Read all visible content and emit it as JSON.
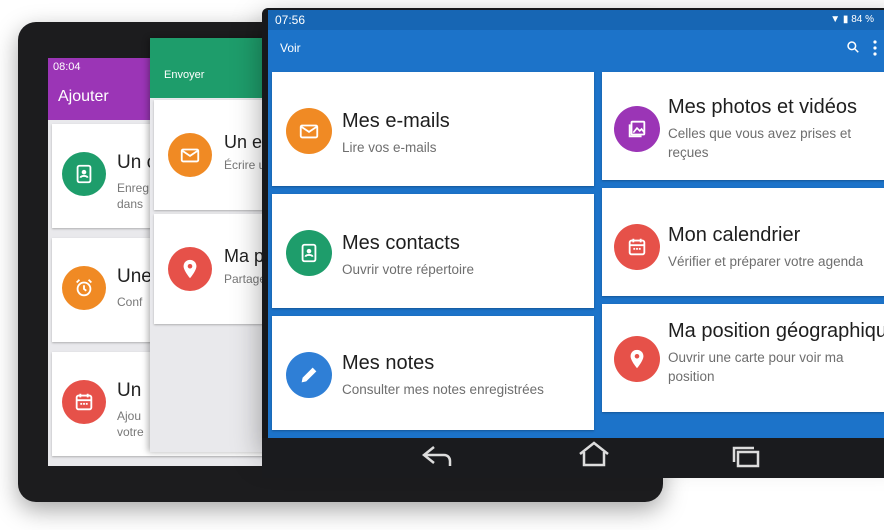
{
  "back_tablet": {
    "status_time": "08:04",
    "title": "Ajouter",
    "accent": "#9b35b6",
    "cards": [
      {
        "title": "Un c",
        "subtitle": "Enreg dans",
        "icon": "contact-icon",
        "color": "#1e9d6b"
      },
      {
        "title": "Une",
        "subtitle": "Conf",
        "icon": "alarm-icon",
        "color": "#f08a24"
      },
      {
        "title": "Un",
        "subtitle": "Ajou votre",
        "icon": "calendar-icon",
        "color": "#e65149"
      }
    ]
  },
  "mid_tablet": {
    "title": "Envoyer",
    "accent": "#1e9d6b",
    "cards": [
      {
        "title": "Un e-",
        "subtitle": "Écrire u",
        "icon": "email-icon",
        "color": "#f08a24"
      },
      {
        "title": "Ma po",
        "subtitle": "Partage",
        "icon": "location-icon",
        "color": "#e65149"
      }
    ]
  },
  "front_tablet": {
    "status_time": "07:56",
    "battery": "84 %",
    "title": "Voir",
    "accent": "#1c73c9",
    "cards": [
      {
        "title": "Mes e-mails",
        "subtitle": "Lire vos e-mails",
        "icon": "email-icon",
        "color": "#f08a24"
      },
      {
        "title": "Mes photos et vidéos",
        "subtitle": "Celles que vous avez prises et reçues",
        "icon": "photo-icon",
        "color": "#9b35b6"
      },
      {
        "title": "Mes contacts",
        "subtitle": "Ouvrir votre répertoire",
        "icon": "contact-icon",
        "color": "#1e9d6b"
      },
      {
        "title": "Mon calendrier",
        "subtitle": "Vérifier et préparer votre agenda",
        "icon": "calendar-icon",
        "color": "#e65149"
      },
      {
        "title": "Mes notes",
        "subtitle": "Consulter mes notes enregistrées",
        "icon": "pencil-icon",
        "color": "#2f7fd6"
      },
      {
        "title": "Ma position géographique",
        "subtitle": "Ouvrir une carte pour voir ma position",
        "icon": "location-icon",
        "color": "#e65149"
      }
    ]
  }
}
